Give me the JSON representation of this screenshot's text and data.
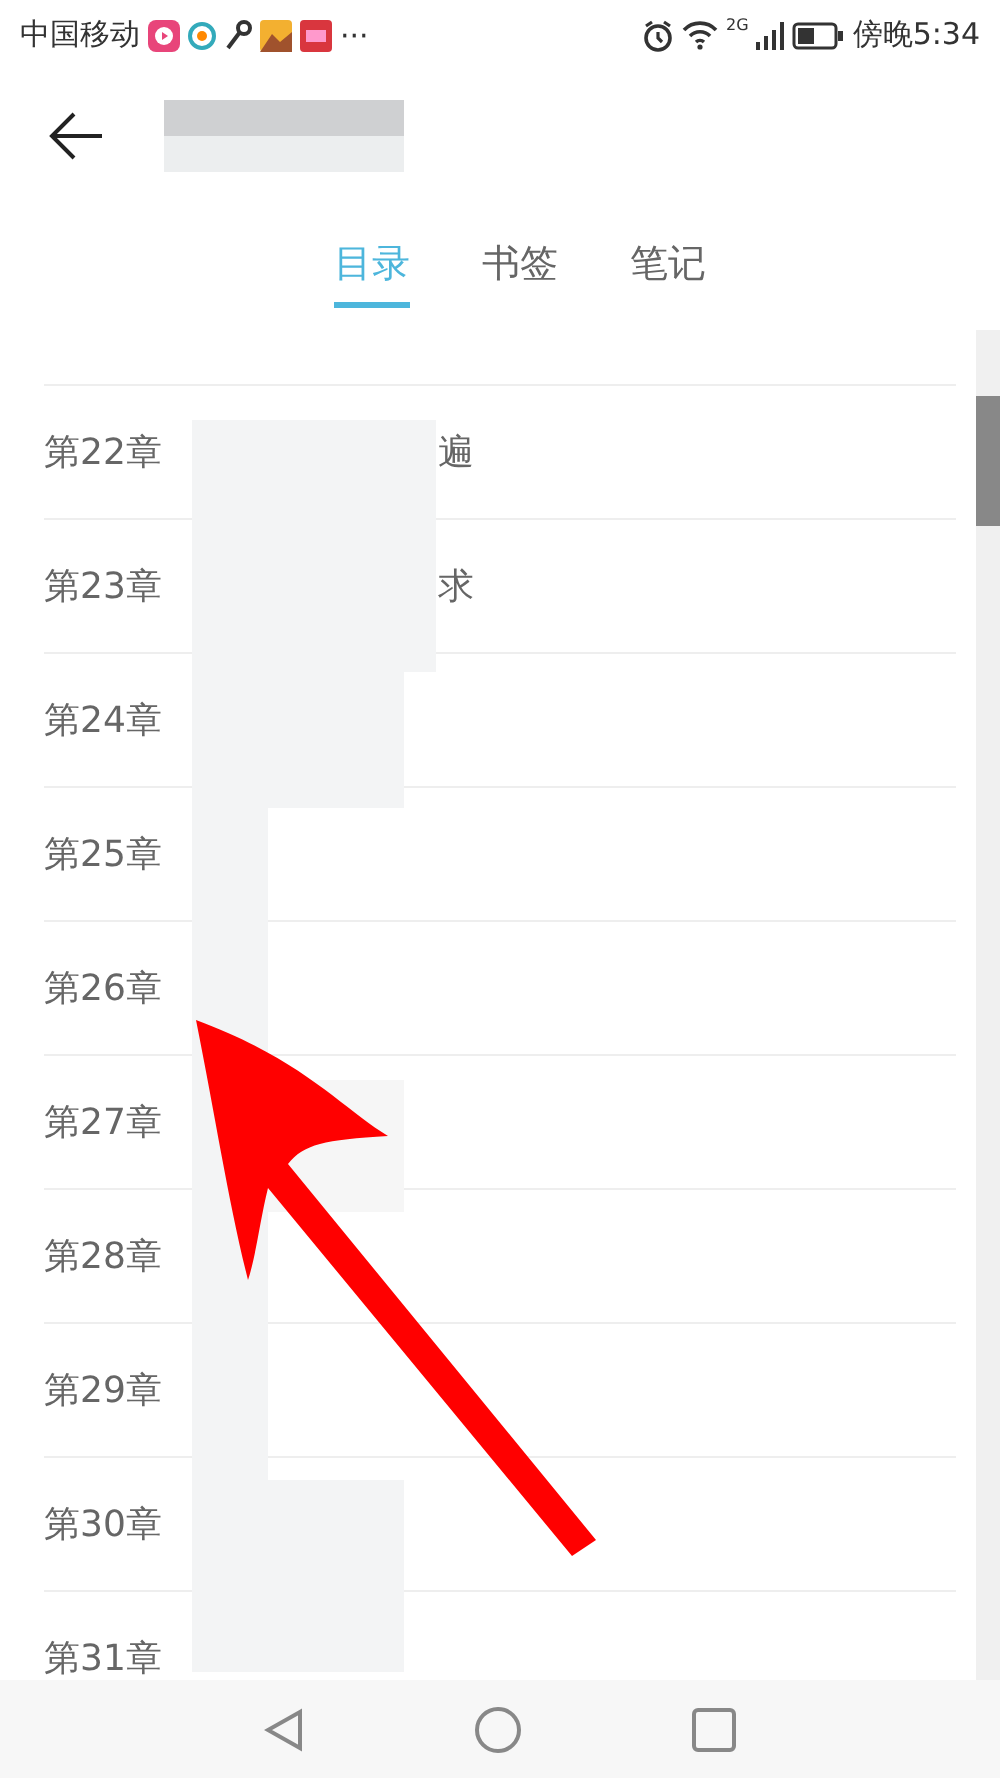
{
  "status_bar": {
    "carrier": "中国移动",
    "more": "···",
    "network": "2G",
    "time": "傍晚5:34"
  },
  "tabs": [
    {
      "label": "目录",
      "selected": true
    },
    {
      "label": "书签",
      "selected": false
    },
    {
      "label": "笔记",
      "selected": false
    }
  ],
  "chapters": [
    {
      "label": "第22章",
      "tail": "遍"
    },
    {
      "label": "第23章",
      "tail": "求"
    },
    {
      "label": "第24章"
    },
    {
      "label": "第25章"
    },
    {
      "label": "第26章"
    },
    {
      "label": "第27章"
    },
    {
      "label": "第28章"
    },
    {
      "label": "第29章"
    },
    {
      "label": "第30章"
    },
    {
      "label": "第31章"
    }
  ]
}
